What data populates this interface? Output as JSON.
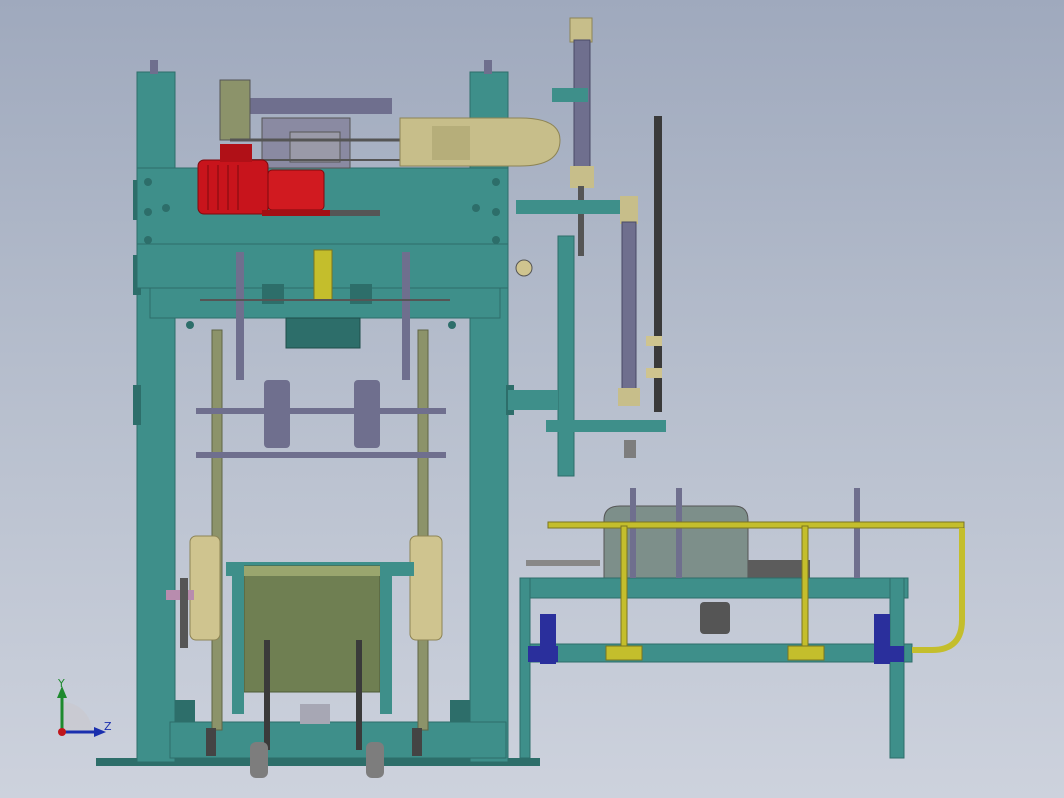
{
  "viewport": {
    "triad_x_label": "",
    "triad_y_label": "Y",
    "triad_z_label": "Z"
  },
  "colors": {
    "background_top": "#9fa9bd",
    "background_bottom": "#cdd2dd",
    "frame_teal": "#3e8f8a",
    "frame_teal_dark": "#2d6e6a",
    "motor_red": "#c8141c",
    "rail_yellow": "#c4be2c",
    "cylinder_purple": "#6f6f8e",
    "roller_olive": "#8c936a",
    "guard_khaki": "#cfc48f",
    "bracket_blue": "#2a2f9c",
    "triad_x": "#c0161c",
    "triad_y": "#1e8a2e",
    "triad_z": "#1a2fae"
  },
  "icons": [
    "coordinate-triad-icon"
  ]
}
